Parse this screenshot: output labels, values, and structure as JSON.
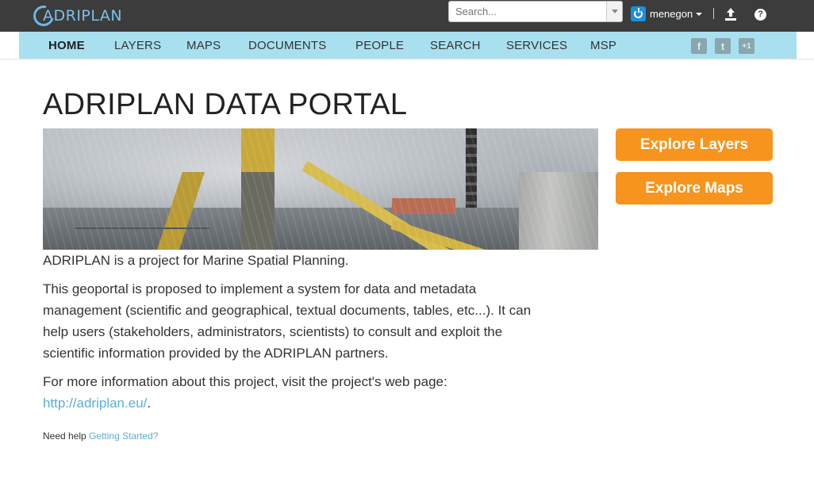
{
  "header": {
    "logo_text": "ADRIPLAN",
    "search_placeholder": "Search...",
    "username": "menegon"
  },
  "nav": {
    "items": [
      {
        "label": "HOME",
        "active": true
      },
      {
        "label": "LAYERS"
      },
      {
        "label": "MAPS"
      },
      {
        "label": "DOCUMENTS"
      },
      {
        "label": "PEOPLE"
      },
      {
        "label": "SEARCH"
      },
      {
        "label": "SERVICES"
      },
      {
        "label": "MSP"
      }
    ],
    "social": [
      "facebook-icon",
      "twitter-icon",
      "google-plus-icon"
    ],
    "social_labels": [
      "f",
      "t",
      "+1"
    ]
  },
  "main": {
    "title": "ADRIPLAN DATA PORTAL",
    "intro": "ADRIPLAN is a project for Marine Spatial Planning.",
    "description": "This geoportal is proposed to implement a system for data and metadata management (scientific and geographical, textual documents, tables, etc...). It can help users (stakeholders, administrators, scientists) to consult and exploit the scientific information provided by the ADRIPLAN partners.",
    "more_info": "For more information about this project, visit the project's web page:",
    "project_link": "http://adriplan.eu/",
    "period": ".",
    "help_text": "Need help",
    "help_link": "Getting Started?"
  },
  "actions": {
    "explore_layers": "Explore Layers",
    "explore_maps": "Explore Maps"
  },
  "colors": {
    "topbar": "#3c3c3c",
    "navbar": "#a9e0ef",
    "accent_orange": "#f7941d",
    "link": "#5aaed8"
  }
}
